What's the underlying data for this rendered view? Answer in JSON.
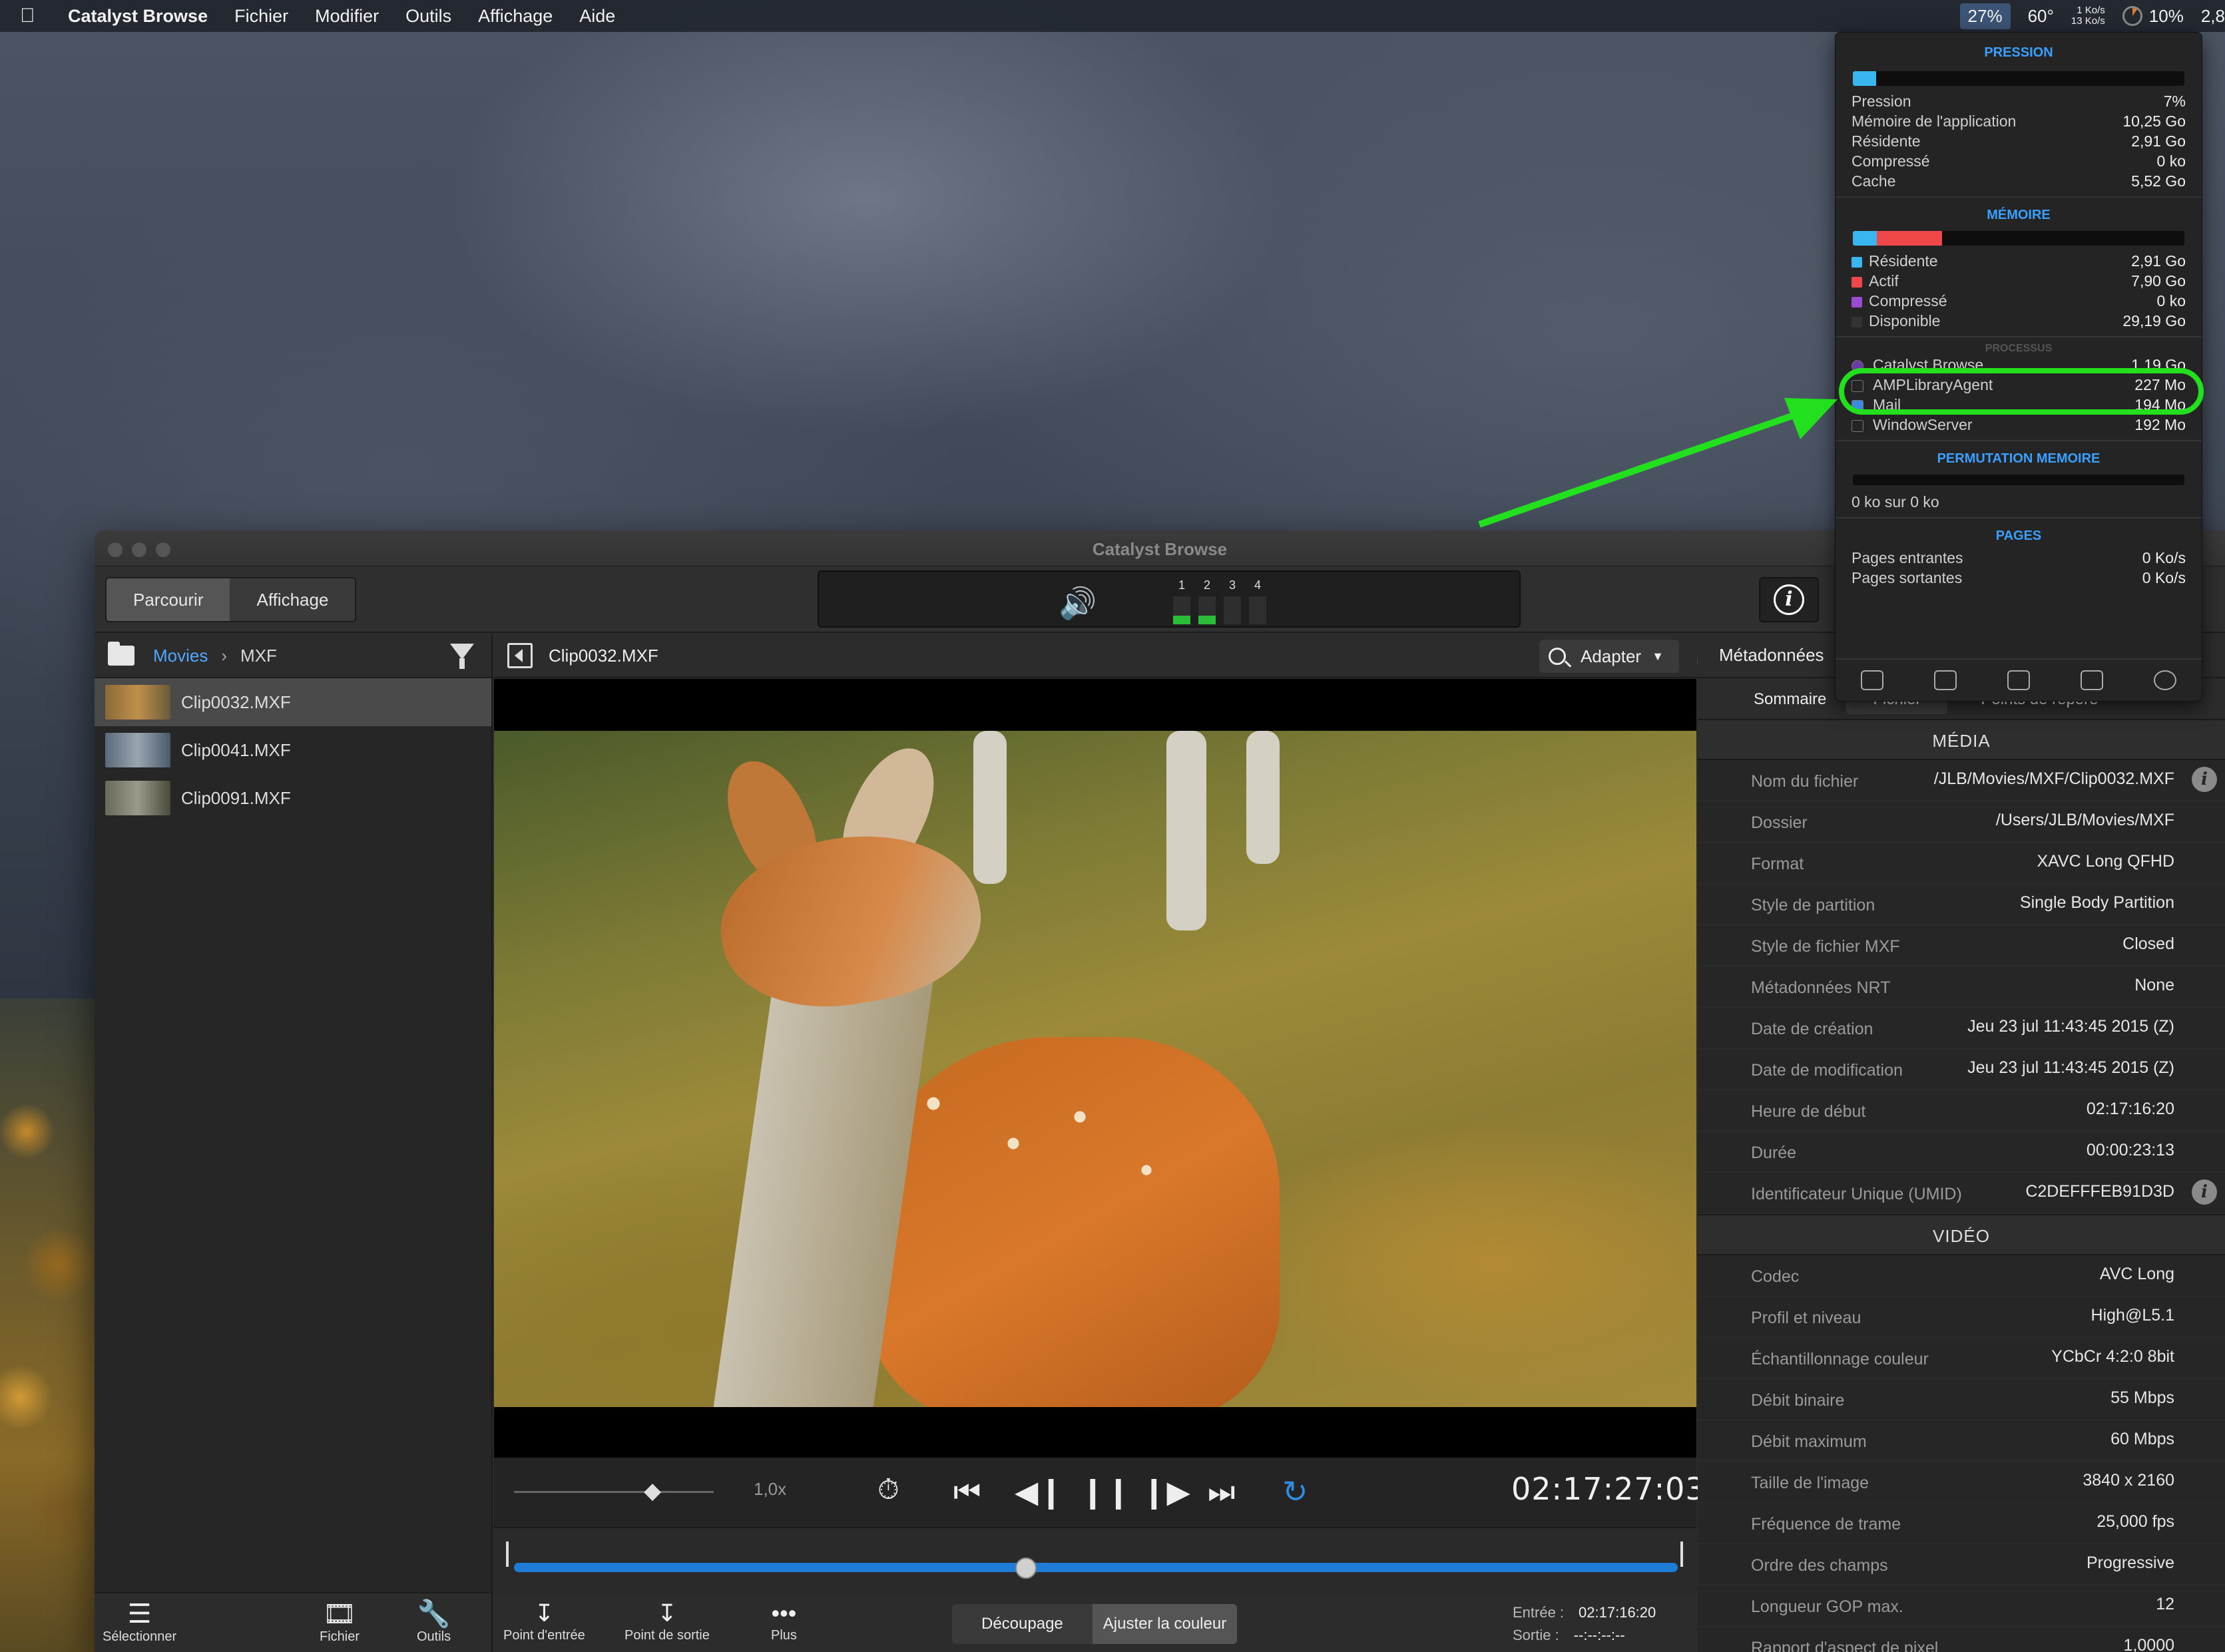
{
  "menubar": {
    "app_name": "Catalyst Browse",
    "menus": [
      "Fichier",
      "Modifier",
      "Outils",
      "Affichage",
      "Aide"
    ],
    "stats": {
      "memory": "27%",
      "temp": "60°",
      "net_up": "1 Ko/s",
      "net_down": "13 Ko/s",
      "battery": "10%",
      "extra": "2,8"
    }
  },
  "popover": {
    "pression_header": "PRESSION",
    "pression_rows": [
      {
        "label": "Pression",
        "value": "7%"
      },
      {
        "label": "Mémoire de l'application",
        "value": "10,25 Go"
      },
      {
        "label": "Résidente",
        "value": "2,91 Go"
      },
      {
        "label": "Compressé",
        "value": "0 ko"
      },
      {
        "label": "Cache",
        "value": "5,52 Go"
      }
    ],
    "pression_fill": 0.07,
    "memoire_header": "MÉMOIRE",
    "memoire_rows": [
      {
        "label": "Résidente",
        "value": "2,91 Go",
        "color": "#39b6f0"
      },
      {
        "label": "Actif",
        "value": "7,90 Go",
        "color": "#f04848"
      },
      {
        "label": "Compressé",
        "value": "0 ko",
        "color": "#9a4ad0"
      },
      {
        "label": "Disponible",
        "value": "29,19 Go",
        "color": "#333333"
      }
    ],
    "processus_header": "PROCESSUS",
    "processes": [
      {
        "name": "Catalyst Browse",
        "value": "1,19 Go",
        "icon": "catalyst-icon"
      },
      {
        "name": "AMPLibraryAgent",
        "value": "227 Mo",
        "icon": "terminal-icon"
      },
      {
        "name": "Mail",
        "value": "194 Mo",
        "icon": "mail-icon"
      },
      {
        "name": "WindowServer",
        "value": "192 Mo",
        "icon": "terminal-icon"
      }
    ],
    "swap_header": "PERMUTATION MEMOIRE",
    "swap_text": "0 ko sur 0 ko",
    "pages_header": "PAGES",
    "pages_rows": [
      {
        "label": "Pages entrantes",
        "value": "0 Ko/s"
      },
      {
        "label": "Pages sortantes",
        "value": "0 Ko/s"
      }
    ]
  },
  "window": {
    "title": "Catalyst Browse",
    "mode_tabs": [
      "Parcourir",
      "Affichage"
    ],
    "audio_channels": [
      {
        "label": "1",
        "level": 0.3
      },
      {
        "label": "2",
        "level": 0.3
      },
      {
        "label": "3",
        "level": 0
      },
      {
        "label": "4",
        "level": 0
      }
    ]
  },
  "browser": {
    "breadcrumb": [
      "Movies",
      "MXF"
    ],
    "files": [
      {
        "name": "Clip0032.MXF",
        "selected": true
      },
      {
        "name": "Clip0041.MXF",
        "selected": false
      },
      {
        "name": "Clip0091.MXF",
        "selected": false
      }
    ],
    "tools": [
      "Sélectionner",
      "Fichier",
      "Outils"
    ]
  },
  "viewer": {
    "clip_title": "Clip0032.MXF",
    "zoom_label": "Adapter",
    "speed": "1,0x",
    "timecode": "02:17:27:03",
    "playhead": 0.44,
    "bottom_tools": [
      "Point d'entrée",
      "Point de sortie",
      "Plus"
    ],
    "bottom_tabs": [
      "Découpage",
      "Ajuster la couleur"
    ],
    "in_label": "Entrée :",
    "in_value": "02:17:16:20",
    "out_label": "Sortie :",
    "out_value": "--:--:--:--"
  },
  "metadata": {
    "header": "Métadonnées",
    "tabs": [
      "Sommaire",
      "Fichier",
      "Points de repère"
    ],
    "media_section": "MÉDIA",
    "media_rows": [
      {
        "label": "Nom du fichier",
        "value": "/JLB/Movies/MXF/Clip0032.MXF",
        "info": true
      },
      {
        "label": "Dossier",
        "value": "/Users/JLB/Movies/MXF"
      },
      {
        "label": "Format",
        "value": "XAVC Long QFHD"
      },
      {
        "label": "Style de partition",
        "value": "Single Body Partition"
      },
      {
        "label": "Style de fichier MXF",
        "value": "Closed"
      },
      {
        "label": "Métadonnées NRT",
        "value": "None"
      },
      {
        "label": "Date de création",
        "value": "Jeu 23 jul 11:43:45 2015 (Z)"
      },
      {
        "label": "Date de modification",
        "value": "Jeu 23 jul 11:43:45 2015 (Z)"
      },
      {
        "label": "Heure de début",
        "value": "02:17:16:20"
      },
      {
        "label": "Durée",
        "value": "00:00:23:13"
      },
      {
        "label": "Identificateur Unique (UMID)",
        "value": "C2DEFFFEB91D3D",
        "info": true
      }
    ],
    "video_section": "VIDÉO",
    "video_rows": [
      {
        "label": "Codec",
        "value": "AVC Long"
      },
      {
        "label": "Profil et niveau",
        "value": "High@L5.1"
      },
      {
        "label": "Échantillonnage couleur",
        "value": "YCbCr 4:2:0 8bit"
      },
      {
        "label": "Débit binaire",
        "value": "55 Mbps"
      },
      {
        "label": "Débit maximum",
        "value": "60 Mbps"
      },
      {
        "label": "Taille de l'image",
        "value": "3840 x 2160"
      },
      {
        "label": "Fréquence de trame",
        "value": "25,000 fps"
      },
      {
        "label": "Ordre des champs",
        "value": "Progressive"
      },
      {
        "label": "Longueur GOP max.",
        "value": "12"
      },
      {
        "label": "Rapport d'aspect de pixel",
        "value": "1,0000"
      }
    ]
  }
}
